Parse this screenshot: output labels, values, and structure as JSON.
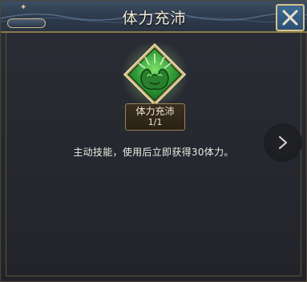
{
  "dialog": {
    "title": "体力充沛",
    "close_icon": "close-x-icon"
  },
  "skill": {
    "icon": "muscle-arm-icon",
    "name": "体力充沛",
    "level": "1/1",
    "description": "主动技能，使用后立即获得30体力。"
  },
  "navigation": {
    "next_icon": "chevron-right-icon"
  },
  "colors": {
    "title_bar": "#2f3d4f",
    "gold_border": "#d7c38a",
    "icon_green": "#3fae3a",
    "close_button": "#2c4f75"
  }
}
